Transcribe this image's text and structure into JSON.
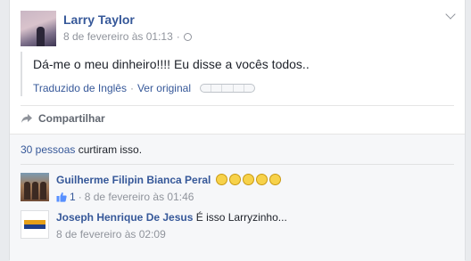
{
  "post": {
    "author": "Larry Taylor",
    "timestamp": "8 de fevereiro às 01:13",
    "separator": "·",
    "text": "Dá-me o meu dinheiro!!!! Eu disse a vocês todos..",
    "translation": {
      "translated_label": "Traduzido de Inglês",
      "separator": "·",
      "see_original": "Ver original"
    },
    "share_label": "Compartilhar"
  },
  "likes": {
    "count_link": "30 pessoas",
    "suffix": " curtiram isso."
  },
  "comments": [
    {
      "name": "Guilherme Filipin Bianca Peral",
      "emoji_count": 5,
      "like_count": "1",
      "separator": "·",
      "timestamp": "8 de fevereiro às 01:46"
    },
    {
      "name": "Joseph Henrique De Jesus",
      "text": "É isso Larryzinho...",
      "timestamp": "8 de fevereiro às 02:09"
    }
  ],
  "colors": {
    "link": "#365899",
    "meta": "#90949c",
    "background": "#e9ebee",
    "feedback_bg": "#f6f7f9"
  },
  "icons": [
    "globe-icon",
    "chevron-down-icon",
    "share-icon",
    "thumbs-up-icon",
    "laughing-emoji-icon"
  ]
}
